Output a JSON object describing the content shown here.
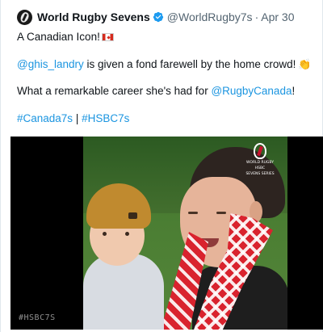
{
  "tweet": {
    "author": {
      "display_name": "World Rugby Sevens",
      "handle": "@WorldRugby7s",
      "separator": "·",
      "date": "Apr 30"
    },
    "text": {
      "line1": "A Canadian Icon!",
      "line2_mention": "@ghis_landry",
      "line2_rest": " is given a fond farewell by the home crowd!",
      "line3_prefix": "What a remarkable career she's had for ",
      "line3_mention": "@RugbyCanada",
      "line3_suffix": "!",
      "hashtag1": "#Canada7s",
      "hashtag_separator": " | ",
      "hashtag2": "#HSBC7s"
    },
    "emojis": {
      "flag": "canada-flag-icon",
      "clap": "👏"
    },
    "media": {
      "logo_lines": [
        "WORLD RUGBY",
        "HSBC",
        "SEVENS SERIES"
      ],
      "overlay_tag": "#HSBC7S"
    }
  },
  "colors": {
    "link": "#1b95e0",
    "verified": "#1d9bf0",
    "text": "#0f1419",
    "secondary": "#536471"
  }
}
